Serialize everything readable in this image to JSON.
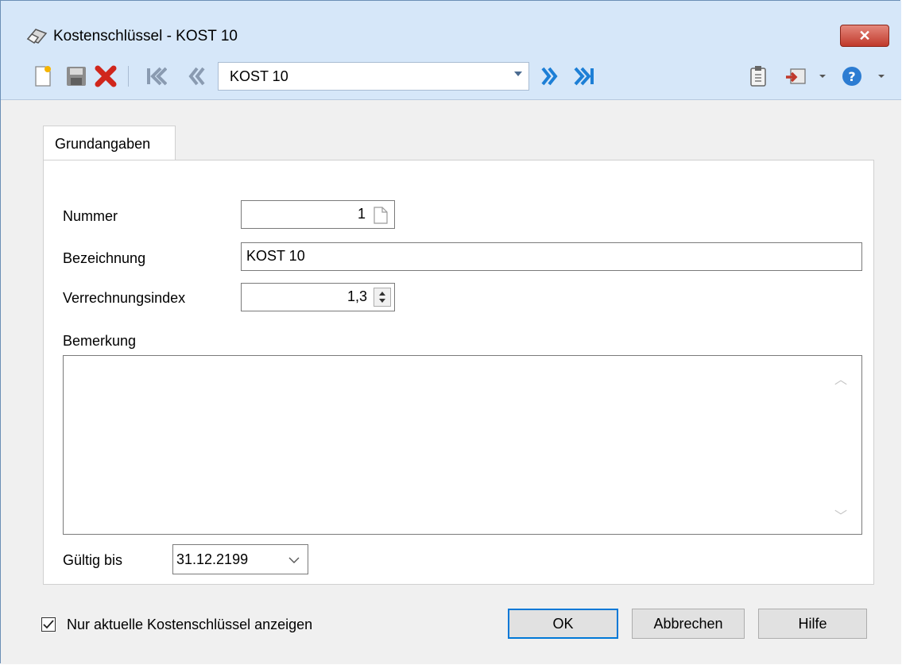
{
  "window": {
    "title": "Kostenschlüssel - KOST 10",
    "close_label": "✕"
  },
  "toolbar": {
    "record_select_value": "KOST 10",
    "buttons": [
      "new-icon",
      "save-icon",
      "delete-icon",
      "first-record-icon",
      "previous-record-icon",
      "next-record-icon",
      "last-record-icon",
      "clipboard-icon",
      "import-icon",
      "help-icon"
    ]
  },
  "tabs": [
    {
      "label": "Grundangaben"
    }
  ],
  "form": {
    "nummer_label": "Nummer",
    "nummer_value": "1",
    "bezeichnung_label": "Bezeichnung",
    "bezeichnung_value": "KOST 10",
    "verrechnungsindex_label": "Verrechnungsindex",
    "verrechnungsindex_value": "1,3",
    "bemerkung_label": "Bemerkung",
    "bemerkung_value": "",
    "gueltig_label": "Gültig bis",
    "gueltig_value": "31.12.2199"
  },
  "footer": {
    "checkbox_label": "Nur aktuelle Kostenschlüssel anzeigen",
    "checkbox_checked": true,
    "ok_label": "OK",
    "cancel_label": "Abbrechen",
    "help_label": "Hilfe"
  }
}
